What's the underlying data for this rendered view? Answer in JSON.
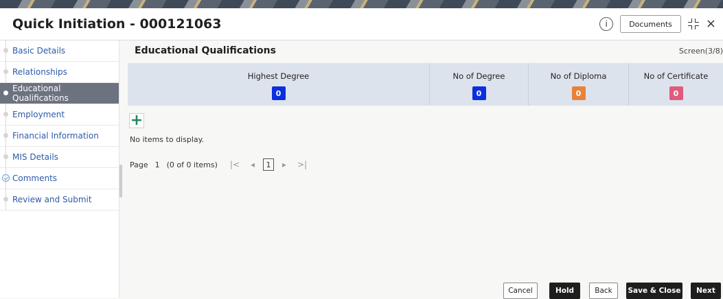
{
  "header": {
    "title": "Quick Initiation - 000121063",
    "info_icon": "info-icon",
    "documents_label": "Documents",
    "expand_icon": "expand-icon",
    "close_label": "×"
  },
  "sidebar": {
    "items": [
      {
        "label": "Basic Details",
        "state": "default"
      },
      {
        "label": "Relationships",
        "state": "default"
      },
      {
        "label": "Educational Qualifications",
        "state": "active"
      },
      {
        "label": "Employment",
        "state": "default"
      },
      {
        "label": "Financial Information",
        "state": "default"
      },
      {
        "label": "MIS Details",
        "state": "default"
      },
      {
        "label": "Comments",
        "state": "completed"
      },
      {
        "label": "Review and Submit",
        "state": "default"
      }
    ]
  },
  "main": {
    "section_title": "Educational Qualifications",
    "screen_indicator": "Screen(3/8)",
    "summary": [
      {
        "label": "Highest Degree",
        "value": "0",
        "color": "#0a2fe0"
      },
      {
        "label": "No of Degree",
        "value": "0",
        "color": "#0a2fe0"
      },
      {
        "label": "No of Diploma",
        "value": "0",
        "color": "#e8823a"
      },
      {
        "label": "No of Certificate",
        "value": "0",
        "color": "#e05a7e"
      }
    ],
    "add_icon": "plus-icon",
    "empty_message": "No items to display.",
    "pager": {
      "page_label": "Page",
      "page_number": "1",
      "items_text": "(0 of 0 items)",
      "first_icon": "|<",
      "prev_icon": "◂",
      "current_page": "1",
      "next_icon": "▸",
      "last_icon": ">|"
    }
  },
  "footer": {
    "cancel": "Cancel",
    "hold": "Hold",
    "back": "Back",
    "save_close": "Save & Close",
    "next": "Next"
  }
}
